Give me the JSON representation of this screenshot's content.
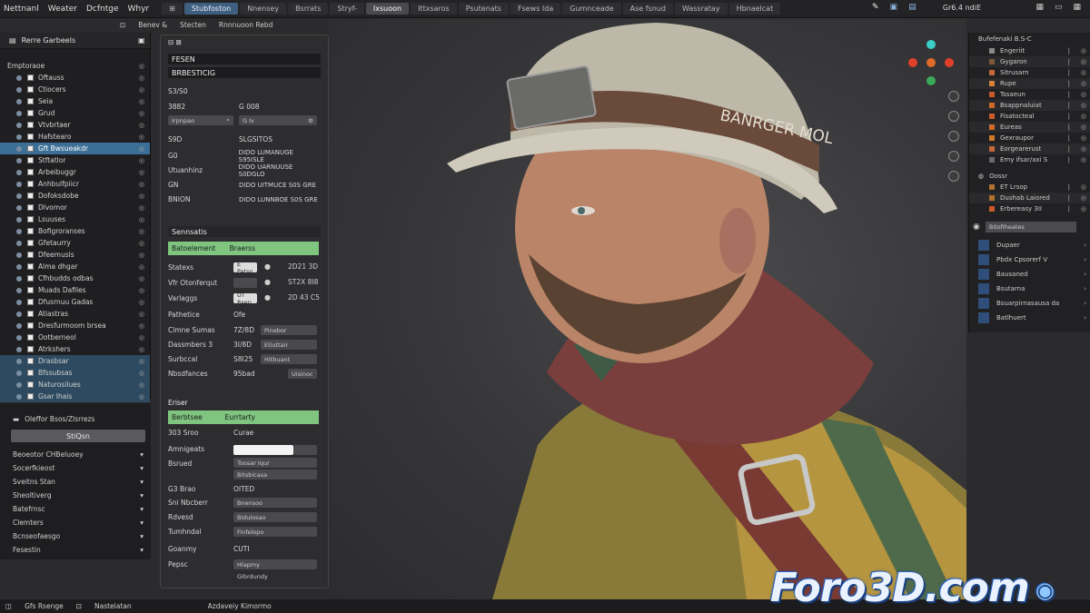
{
  "menu": [
    "Nettnanl",
    "Weater",
    "Dcfntge",
    "Whyr"
  ],
  "workspace_tabs": [
    "Stubfoston",
    "Nnensey",
    "Bsrrats",
    "Stryf-",
    "Ixsuoon",
    "Ittxsaros",
    "Psutenats",
    "Fsews Ida",
    "Gumnceade",
    "Ase fsnud",
    "Wassratay",
    "Hbnaelcat"
  ],
  "sub_tabs": [
    "Benev &",
    "Stecten",
    "Rnnnuoon Rebd"
  ],
  "top_right": "Gr6.4 ndiE",
  "outliner": {
    "title": "Rerre Garbeels",
    "section": "Emptoraoe",
    "items": [
      "Oftauss",
      "Ctiocers",
      "Seia",
      "Grud",
      "Vtvbrtaer",
      "Hafstearo",
      "Gft Bwsueakdr",
      "Stftatlor",
      "Arbeibuggr",
      "Anhbulfpiicr",
      "Dofoksdobe",
      "Dlvomor",
      "Lsuuses",
      "Bofigroranses",
      "Gfetaurry",
      "Dfeemusls",
      "Alma dhgar",
      "Cfhbudds odbas",
      "Muads Dafiles",
      "Dfusrnuu Gadas",
      "Atiastras",
      "Dresfurmoom brsea",
      "Ootberneol",
      "Atrkshers",
      "Drasbsar",
      "Bfssubsas",
      "Naturosilues",
      "Gsar Ihais"
    ]
  },
  "left_lower": {
    "header": "Oleffor Bsos/Zlsrrezs",
    "button": "StiQsn",
    "rows": [
      "Beoeotor CHBeluoey",
      "Socerfkieost",
      "Sveitns Stan",
      "Sheoltiverg",
      "Batefrnsc",
      "Clemters",
      "Bcnseofaesgo",
      "Fesestin"
    ]
  },
  "props": {
    "band1": "FESEN",
    "band2": "BRBESTICIG",
    "label_a": "S3/S0",
    "r1_left": "3882",
    "r1_right": "G 008",
    "sel_left": "Irpnpao",
    "sel_right": "G Iv",
    "r2_left": "S9D",
    "r2_right": "SLGSITOS",
    "r3_left": "G0",
    "r3_right": "DIDO LUMANUGE S95ISLE",
    "r4_left": "Utuanhinz",
    "r4_right": "DIDO UARNUUSE S0DGLO",
    "r5_left": "GN",
    "r5_right": "DIDO UITMUCE S0S GRE",
    "r6_left": "BNION",
    "r6_right": "DIDO LUNNBOE S0S GRE",
    "section2": "Sennsatis",
    "green1_left": "Batoelement",
    "green1_right": "Braerss",
    "p1": "Statexs",
    "p1f": "E Patsn",
    "p1v": "2D21 3D",
    "p2": "Vfr Otonferqut",
    "p2f": "",
    "p2v": "ST2X 8I8",
    "p3": "Varlaggs",
    "p3f": "UT 8xen",
    "p3v": "2D 43 C5",
    "p4": "Pathetice",
    "p4v": "Ofe",
    "p5": "Clmne Sumas",
    "p5v": "7Z/8D",
    "p5f": "Pinebor",
    "p6": "Dassmbers 3",
    "p6v": "3I/8D",
    "p6f": "Etiuttair",
    "p7": "Surbccal",
    "p7v": "S8I25",
    "p7f": "Hitbuant",
    "p8": "Nbsdfances",
    "p8v": "95bad",
    "p8f": "Uisinoc",
    "section3": "Eriser",
    "green2_left": "Berbtsee",
    "green2_right": "Eurrtarty",
    "q1": "303 Sroo",
    "q1v": "Curae",
    "q2": "Amnigeats",
    "q3": "Bsrued",
    "q3f": "Toosar Iqur",
    "q3f2": "Bitsbicasa",
    "q4": "G3  Brao",
    "q4v": "OITED",
    "q5": "Sni Nbcberr",
    "q5f": "Bnensoo",
    "q6": "Rdvesd",
    "q6f": "Bidulosao",
    "q7": "Tumhndal",
    "q7f": "Finfelopo",
    "q8": "Goanmy",
    "q8v": "CUTI",
    "q9": "Pepsc",
    "q9f": "Hlapmy",
    "q9f2": "Gibrdundy"
  },
  "viewport": {
    "tabs": [
      "Lpnerrepu",
      "Cirspoe",
      "Bhsroadic"
    ],
    "helmet_text": "BANRGER MOL"
  },
  "right_panel": {
    "title": "Bufefenaki B.S-C",
    "items": [
      {
        "name": "Engeriit",
        "color": "#888888"
      },
      {
        "name": "Gygaron",
        "color": "#7a5a3a"
      },
      {
        "name": "Sitrusarn",
        "color": "#c46a3a"
      },
      {
        "name": "Rupe",
        "color": "#d8813a"
      },
      {
        "name": "Tssaeun",
        "color": "#c85a2a"
      },
      {
        "name": "Bsappnaluiat",
        "color": "#cc6a2a"
      },
      {
        "name": "Fisatocteal",
        "color": "#cc5a2a"
      },
      {
        "name": "Eureas",
        "color": "#d06a2a"
      },
      {
        "name": "Gexraupor",
        "color": "#d07a2a"
      },
      {
        "name": "Eorgearerust",
        "color": "#c46a3a"
      },
      {
        "name": "Emy ifsar/axi S",
        "color": "#6a6a6a"
      }
    ],
    "sub_title": "Oossr",
    "sub_items": [
      {
        "name": "ET Lrsop",
        "color": "#b07030"
      },
      {
        "name": "Dushab Laiored",
        "color": "#b07030"
      },
      {
        "name": "Erbereasy 3II",
        "color": "#cc5a2a"
      }
    ],
    "search": "Bitofiheates",
    "mats": [
      "Dupaer",
      "Pbdx Cpsorerf V",
      "Bausaned",
      "Bsutarna",
      "Bsuarpirnasausa da",
      "Batlhuert"
    ]
  },
  "bottom": [
    "Gfs Rsenge",
    "Nastelatan",
    "Azdaveiy Kimormo"
  ],
  "watermark": "Foro3D.com"
}
